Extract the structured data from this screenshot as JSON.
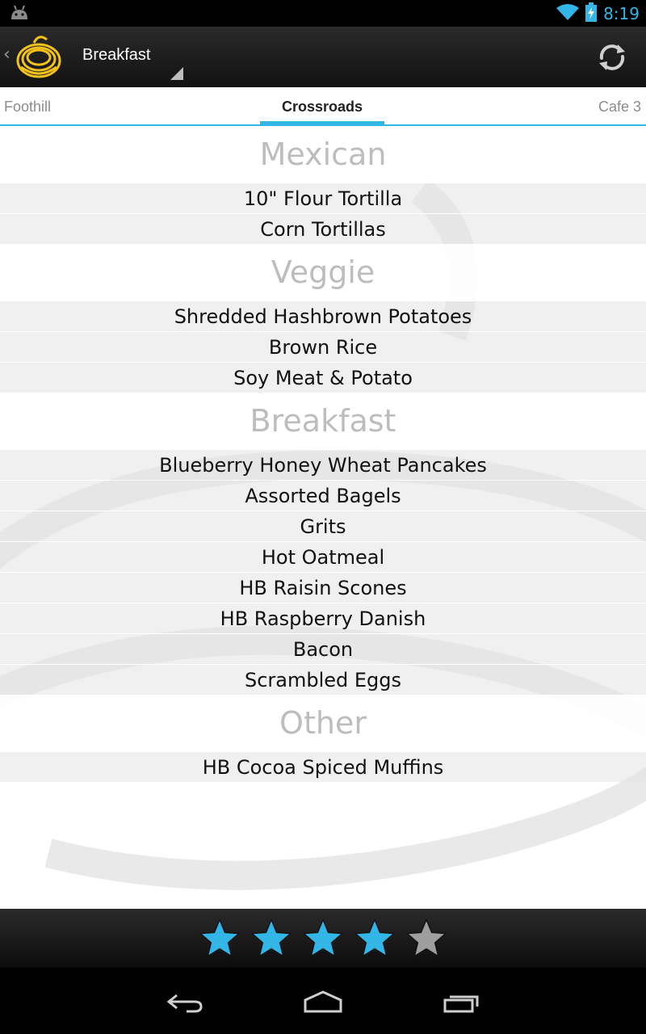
{
  "status_bar": {
    "time": "8:19",
    "icons": [
      "android-debug-icon",
      "wifi-icon",
      "battery-charging-icon"
    ],
    "accent": "#33b5e5"
  },
  "action_bar": {
    "title": "Breakfast",
    "logo": "yellow-spiral-logo-icon",
    "refresh": "refresh-icon"
  },
  "tabs": [
    {
      "label": "Foothill",
      "selected": false
    },
    {
      "label": "Crossroads",
      "selected": true
    },
    {
      "label": "Cafe 3",
      "selected": false
    }
  ],
  "menu": {
    "sections": [
      {
        "title": "Mexican",
        "items": [
          "10\" Flour Tortilla",
          "Corn Tortillas"
        ]
      },
      {
        "title": "Veggie",
        "items": [
          "Shredded Hashbrown Potatoes",
          "Brown Rice",
          "Soy Meat & Potato"
        ]
      },
      {
        "title": "Breakfast",
        "items": [
          "Blueberry Honey Wheat Pancakes",
          "Assorted Bagels",
          "Grits",
          "Hot Oatmeal",
          "HB Raisin Scones",
          "HB Raspberry Danish",
          "Bacon",
          "Scrambled Eggs"
        ]
      },
      {
        "title": "Other",
        "items": [
          "HB Cocoa Spiced Muffins"
        ]
      }
    ]
  },
  "rating": {
    "value": 4,
    "max": 5,
    "filled_color": "#33b5e5",
    "empty_color": "#9e9e9e"
  },
  "nav_bar": {
    "buttons": [
      "back-icon",
      "home-icon",
      "recent-apps-icon"
    ]
  }
}
